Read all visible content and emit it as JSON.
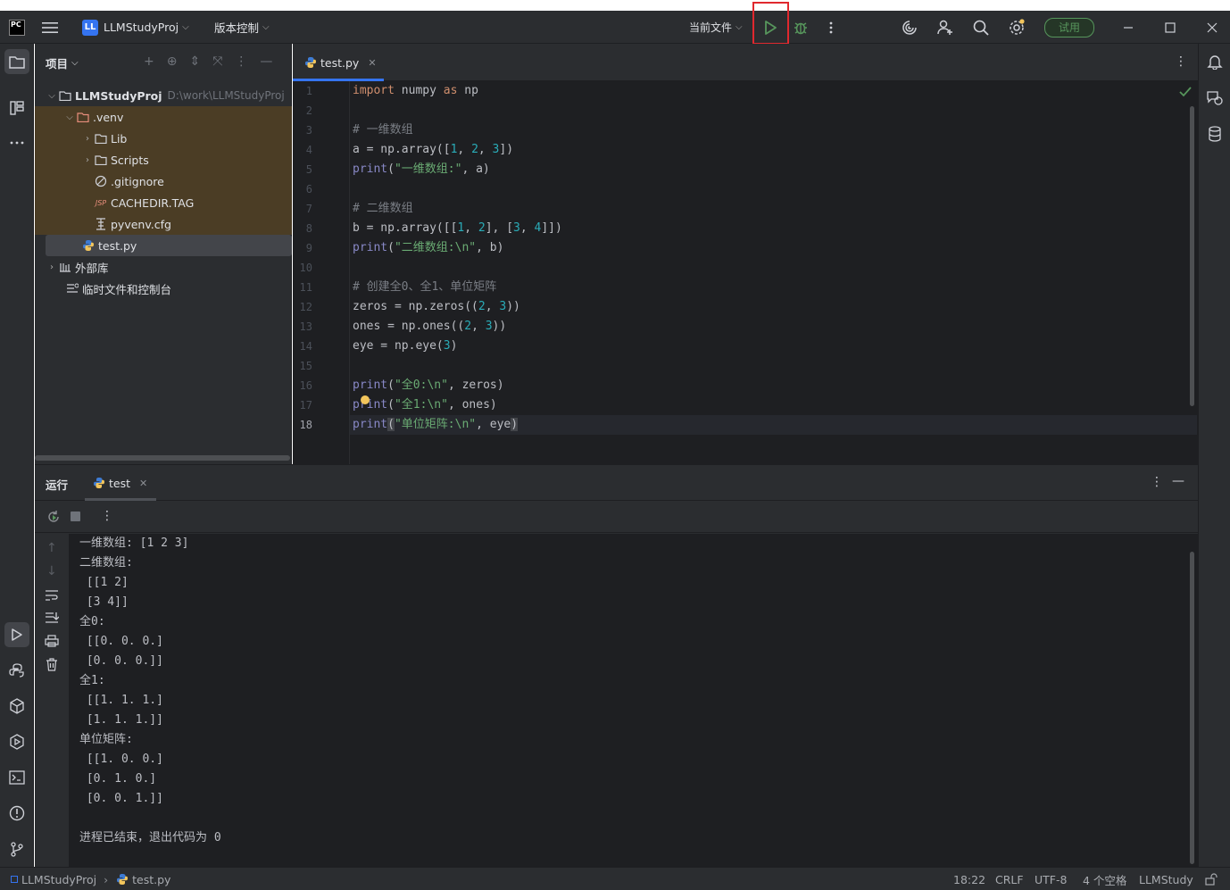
{
  "titlebar": {
    "app_icon": "PC",
    "project_badge": "LL",
    "project_name": "LLMStudyProj",
    "vcs_label": "版本控制",
    "run_config": "当前文件",
    "try_label": "试用",
    "icons": [
      "menu-icon",
      "run-icon",
      "debug-icon",
      "more-icon",
      "ai-icon",
      "add-user-icon",
      "search-icon",
      "settings-icon",
      "minimize-icon",
      "maximize-icon",
      "close-icon"
    ]
  },
  "project_panel": {
    "title": "项目",
    "tree": [
      {
        "label": "LLMStudyProj",
        "path": "D:\\work\\LLMStudyProj",
        "type": "folder",
        "expanded": true
      },
      {
        "label": ".venv",
        "type": "folder",
        "expanded": true
      },
      {
        "label": "Lib",
        "type": "folder",
        "expanded": false
      },
      {
        "label": "Scripts",
        "type": "folder",
        "expanded": false
      },
      {
        "label": ".gitignore",
        "type": "ignore-file"
      },
      {
        "label": "CACHEDIR.TAG",
        "type": "tag-file",
        "icon_text": "JSP"
      },
      {
        "label": "pyvenv.cfg",
        "type": "config-file"
      },
      {
        "label": "test.py",
        "type": "python-file"
      },
      {
        "label": "外部库",
        "type": "library"
      },
      {
        "label": "临时文件和控制台",
        "type": "scratches"
      }
    ]
  },
  "editor": {
    "tab_label": "test.py",
    "current_line": "18",
    "line_numbers": [
      "1",
      "2",
      "3",
      "4",
      "5",
      "6",
      "7",
      "8",
      "9",
      "10",
      "11",
      "12",
      "13",
      "14",
      "15",
      "16",
      "17",
      "18"
    ],
    "code": {
      "l1": {
        "kw1": "import",
        "t1": " numpy ",
        "kw2": "as",
        "t2": " np"
      },
      "l3": "# 一维数组",
      "l4": {
        "t1": "a = np.array([",
        "n1": "1",
        "c1": ", ",
        "n2": "2",
        "c2": ", ",
        "n3": "3",
        "t2": "])"
      },
      "l5": {
        "fn": "print",
        "t1": "(",
        "s": "\"一维数组:\"",
        "t2": ", a)"
      },
      "l7": "# 二维数组",
      "l8": {
        "t1": "b = np.array([[",
        "n1": "1",
        "c1": ", ",
        "n2": "2",
        "t2": "], [",
        "n3": "3",
        "c2": ", ",
        "n4": "4",
        "t3": "]])"
      },
      "l9": {
        "fn": "print",
        "t1": "(",
        "s": "\"二维数组:\\n\"",
        "t2": ", b)"
      },
      "l11": "# 创建全0、全1、单位矩阵",
      "l12": {
        "t1": "zeros = np.zeros((",
        "n1": "2",
        "c1": ", ",
        "n2": "3",
        "t2": "))"
      },
      "l13": {
        "t1": "ones = np.ones((",
        "n1": "2",
        "c1": ", ",
        "n2": "3",
        "t2": "))"
      },
      "l14": {
        "t1": "eye = np.eye(",
        "n1": "3",
        "t2": ")"
      },
      "l16": {
        "fn": "print",
        "t1": "(",
        "s": "\"全0:\\n\"",
        "t2": ", zeros)"
      },
      "l17": {
        "fn": "print",
        "t1": "(",
        "s": "\"全1:\\n\"",
        "t2": ", ones)"
      },
      "l18": {
        "fn": "print",
        "t1": "(",
        "s": "\"单位矩阵:\\n\"",
        "t2": ", eye",
        "t3": ")"
      }
    }
  },
  "run_panel": {
    "title": "运行",
    "tab_label": "test",
    "output": [
      "一维数组: [1 2 3]",
      "二维数组:",
      " [[1 2]",
      " [3 4]]",
      "全0:",
      " [[0. 0. 0.]",
      " [0. 0. 0.]]",
      "全1:",
      " [[1. 1. 1.]",
      " [1. 1. 1.]]",
      "单位矩阵:",
      " [[1. 0. 0.]",
      " [0. 1. 0.]",
      " [0. 0. 1.]]",
      "",
      "进程已结束，退出代码为 0"
    ]
  },
  "statusbar": {
    "breadcrumb_project": "LLMStudyProj",
    "breadcrumb_file": "test.py",
    "position": "18:22",
    "line_sep": "CRLF",
    "encoding": "UTF-8",
    "indent": "4 个空格",
    "interpreter": "LLMStudy"
  },
  "colors": {
    "accent": "#3574f0",
    "run_green": "#57965c",
    "highlight_box": "#e0282e",
    "keyword": "#cf8e6d",
    "string": "#6aab73",
    "number": "#2aacb8"
  }
}
